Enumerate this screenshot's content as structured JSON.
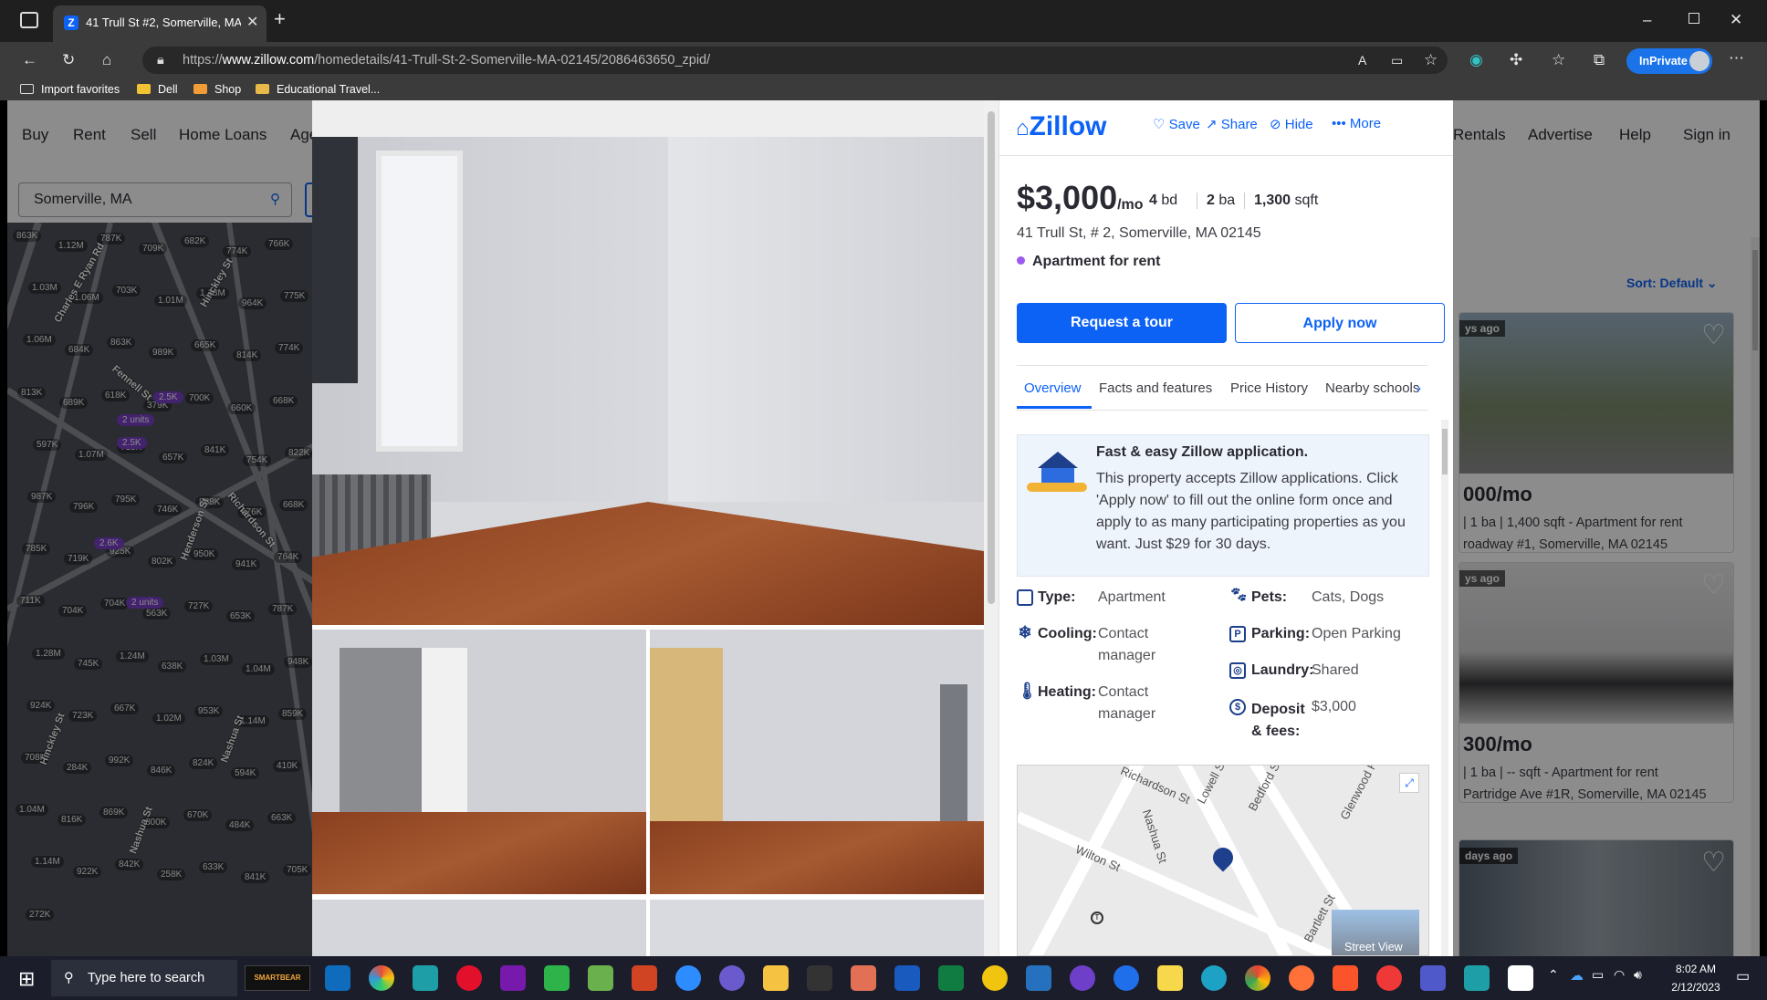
{
  "browser": {
    "tab_title": "41 Trull St #2, Somerville, MA 02",
    "url_prefix": "https://",
    "url_host": "www.zillow.com",
    "url_path": "/homedetails/41-Trull-St-2-Somerville-MA-02145/2086463650_zpid/",
    "profile_label": "InPrivate",
    "favorites": [
      "Import favorites",
      "Dell",
      "Shop",
      "Educational Travel..."
    ]
  },
  "site_nav": {
    "left": [
      "Buy",
      "Rent",
      "Sell",
      "Home Loans",
      "Age"
    ],
    "right": [
      "Rentals",
      "Advertise",
      "Help",
      "Sign in"
    ]
  },
  "search": {
    "value": "Somerville, MA"
  },
  "sort_label": "Sort: Default",
  "map": {
    "price_labels": [
      "863K",
      "1.12M",
      "787K",
      "709K",
      "682K",
      "774K",
      "766K",
      "1.03M",
      "1.06M",
      "703K",
      "1.01M",
      "1.18M",
      "964K",
      "775K",
      "1.06M",
      "684K",
      "863K",
      "989K",
      "665K",
      "814K",
      "774K",
      "813K",
      "689K",
      "618K",
      "379K",
      "700K",
      "660K",
      "668K",
      "597K",
      "1.07M",
      "715K",
      "657K",
      "841K",
      "754K",
      "822K",
      "987K",
      "796K",
      "795K",
      "746K",
      "868K",
      "676K",
      "668K",
      "785K",
      "719K",
      "925K",
      "802K",
      "950K",
      "941K",
      "764K",
      "711K",
      "704K",
      "704K",
      "563K",
      "727K",
      "653K",
      "787K",
      "1.28M",
      "745K",
      "1.24M",
      "638K",
      "1.03M",
      "1.04M",
      "948K",
      "924K",
      "723K",
      "667K",
      "1.02M",
      "953K",
      "1.14M",
      "859K",
      "708K",
      "284K",
      "992K",
      "846K",
      "824K",
      "594K",
      "410K",
      "1.04M",
      "816K",
      "869K",
      "800K",
      "670K",
      "484K",
      "663K",
      "1.14M",
      "922K",
      "842K",
      "258K",
      "633K",
      "841K",
      "705K",
      "272K"
    ],
    "badges": [
      "2.5K",
      "2 units",
      "2.5K",
      "2.6K",
      "2 units"
    ],
    "street_labels": [
      "Charles E Ryan Rd",
      "Hinckley St",
      "Fennell St",
      "Richardson St",
      "Henderson St",
      "Nashua St",
      "Hinckley St",
      "Nashua St"
    ]
  },
  "detail": {
    "logo": "Zillow",
    "actions": [
      "Save",
      "Share",
      "Hide",
      "More"
    ],
    "price": "$3,000",
    "price_unit": "/mo",
    "beds": "4",
    "beds_unit": "bd",
    "baths": "2",
    "baths_unit": "ba",
    "sqft": "1,300",
    "sqft_unit": "sqft",
    "address": "41 Trull St, # 2, Somerville, MA 02145",
    "status": "Apartment for rent",
    "status_color": "#9b59f0",
    "tour_button": "Request a tour",
    "apply_button": "Apply now",
    "tabs": [
      "Overview",
      "Facts and features",
      "Price History",
      "Nearby schools"
    ],
    "promo_title": "Fast & easy Zillow application.",
    "promo_text": "This property accepts Zillow applications. Click 'Apply now' to fill out the online form once and apply to as many participating properties as you want. Just $29 for 30 days.",
    "facts_left": [
      {
        "icon": "building-icon",
        "label": "Type:",
        "value": "Apartment"
      },
      {
        "icon": "snowflake-icon",
        "label": "Cooling:",
        "value": "Contact manager"
      },
      {
        "icon": "thermometer-icon",
        "label": "Heating:",
        "value": "Contact manager"
      }
    ],
    "facts_right": [
      {
        "icon": "paw-icon",
        "label": "Pets:",
        "value": "Cats, Dogs"
      },
      {
        "icon": "parking-icon",
        "label": "Parking:",
        "value": "Open Parking"
      },
      {
        "icon": "laundry-icon",
        "label": "Laundry:",
        "value": "Shared"
      },
      {
        "icon": "dollar-icon",
        "label": "Deposit & fees:",
        "value": "$3,000"
      }
    ],
    "map_streets": [
      "Richardson St",
      "Nashua St",
      "Wilton St",
      "Lowell St",
      "Bedford St",
      "Glenwood Rd",
      "Bartlett St"
    ],
    "street_view_label": "Street View",
    "accent": "#0d62f6"
  },
  "listings": [
    {
      "ago": "ys ago",
      "price": "000/mo",
      "line1": "| 1 ba | 1,400 sqft - Apartment for rent",
      "line2": "roadway #1, Somerville, MA 02145"
    },
    {
      "ago": "ys ago",
      "price": "300/mo",
      "line1": "| 1 ba | -- sqft - Apartment for rent",
      "line2": "Partridge Ave #1R, Somerville, MA 02145"
    },
    {
      "ago": "days ago"
    }
  ],
  "taskbar": {
    "search_placeholder": "Type here to search",
    "smartbear": "SMARTBEAR",
    "time": "8:02 AM",
    "date": "2/12/2023"
  }
}
